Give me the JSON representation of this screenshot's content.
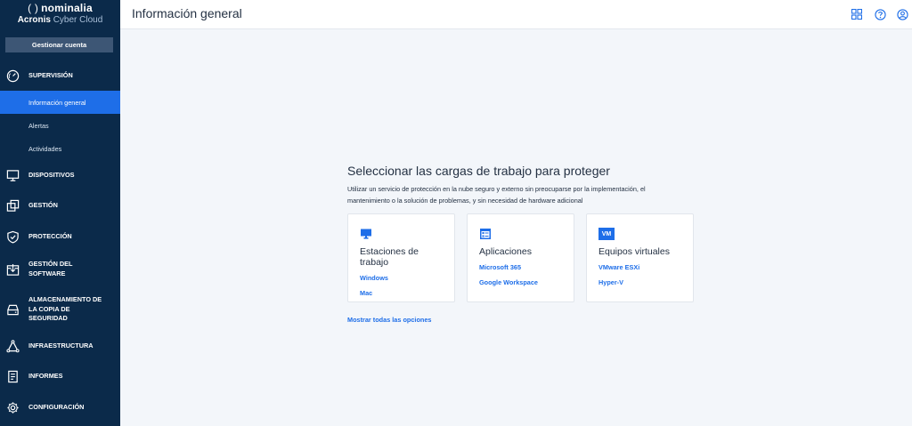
{
  "brand": {
    "line1": "nominalia",
    "paren": "( )",
    "acronis": "Acronis",
    "cyber_cloud": "Cyber Cloud"
  },
  "sidebar": {
    "manage_account": "Gestionar cuenta",
    "supervision": "SUPERVISIÓN",
    "sub_items": [
      "Información general",
      "Alertas",
      "Actividades"
    ],
    "dispositivos": "DISPOSITIVOS",
    "gestion": "GESTIÓN",
    "proteccion": "PROTECCIÓN",
    "gestion_software": [
      "GESTIÓN DEL",
      "SOFTWARE"
    ],
    "almacenamiento": [
      "ALMACENAMIENTO DE",
      "LA COPIA DE",
      "SEGURIDAD"
    ],
    "infraestructura": "INFRAESTRUCTURA",
    "informes": "INFORMES",
    "configuracion": "CONFIGURACIÓN"
  },
  "header": {
    "title": "Información general"
  },
  "main": {
    "title": "Seleccionar las cargas de trabajo para proteger",
    "desc_line1": "Utilizar un servicio de protección en la nube seguro y externo sin preocuparse por la implementación, el",
    "desc_line2": "mantenimiento o la solución de problemas, y sin necesidad de hardware adicional",
    "cards": [
      {
        "title_line1": "Estaciones de",
        "title_line2": "trabajo",
        "links": [
          "Windows",
          "Mac"
        ]
      },
      {
        "title_line1": "Aplicaciones",
        "links": [
          "Microsoft 365",
          "Google Workspace"
        ]
      },
      {
        "title_line1": "Equipos virtuales",
        "links": [
          "VMware ESXi",
          "Hyper-V"
        ],
        "icon_text": "VM"
      }
    ],
    "show_all": "Mostrar todas las opciones"
  },
  "colors": {
    "sidebar": "#0b2a4a",
    "accent": "#1e6ee8",
    "background": "#f3f6fa"
  }
}
